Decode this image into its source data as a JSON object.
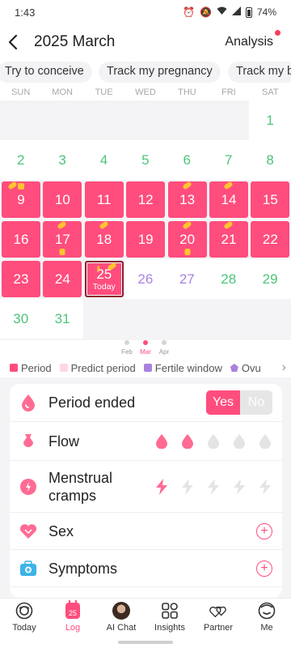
{
  "status_bar": {
    "time": "1:43",
    "battery": "74%"
  },
  "header": {
    "back_icon": "chevron-left-icon",
    "title": "2025 March",
    "action": "Analysis",
    "accent": "#ff3b5c"
  },
  "chips": [
    "Try to conceive",
    "Track my pregnancy",
    "Track my b"
  ],
  "weekdays": [
    "SUN",
    "MON",
    "TUE",
    "WED",
    "THU",
    "FRI",
    "SAT"
  ],
  "calendar": {
    "colors": {
      "period": "#ff4d7d",
      "fertile": "#4cc47a",
      "ovulation": "#a982dd",
      "marker": "#ffc430"
    },
    "days": [
      "1",
      "2",
      "3",
      "4",
      "5",
      "6",
      "7",
      "8",
      "9",
      "10",
      "11",
      "12",
      "13",
      "14",
      "15",
      "16",
      "17",
      "18",
      "19",
      "20",
      "21",
      "22",
      "23",
      "24",
      "25",
      "26",
      "27",
      "28",
      "29",
      "30",
      "31"
    ],
    "today_label": "Today"
  },
  "months": {
    "prev": "Feb",
    "current": "Mar",
    "next": "Apr"
  },
  "legend": [
    {
      "label": "Period",
      "color": "#ff4d7d"
    },
    {
      "label": "Predict period",
      "color": "#ffd6e2"
    },
    {
      "label": "Fertile window",
      "color": "#a982dd"
    },
    {
      "label": "Ovu",
      "color": "#a982dd"
    }
  ],
  "log": {
    "period_ended": {
      "label": "Period ended",
      "yes": "Yes",
      "no": "No",
      "value": "Yes"
    },
    "flow": {
      "label": "Flow",
      "level": 2,
      "max": 5,
      "icon": "drop-icon"
    },
    "cramps": {
      "label_line1": "Menstrual",
      "label_line2": "cramps",
      "level": 1,
      "max": 5,
      "icon": "bolt-icon"
    },
    "sex": {
      "label": "Sex"
    },
    "symptoms": {
      "label": "Symptoms"
    }
  },
  "tabs": [
    {
      "label": "Today",
      "icon": "today-icon"
    },
    {
      "label": "Log",
      "icon": "calendar-icon",
      "badge": "25",
      "active": true
    },
    {
      "label": "AI Chat",
      "icon": "avatar-icon"
    },
    {
      "label": "Insights",
      "icon": "insights-icon"
    },
    {
      "label": "Partner",
      "icon": "partner-icon"
    },
    {
      "label": "Me",
      "icon": "me-icon"
    }
  ]
}
